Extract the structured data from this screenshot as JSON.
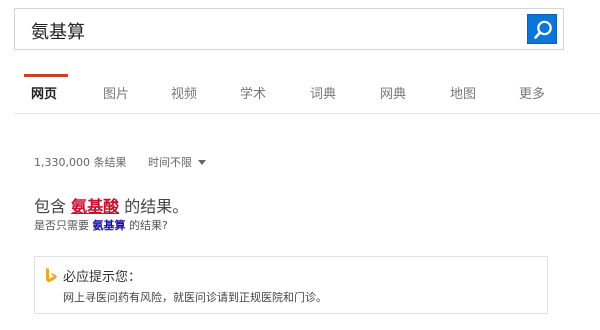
{
  "search": {
    "query": "氨基算"
  },
  "nav": {
    "tabs": [
      {
        "label": "网页",
        "active": true
      },
      {
        "label": "图片"
      },
      {
        "label": "视频"
      },
      {
        "label": "学术"
      },
      {
        "label": "词典"
      },
      {
        "label": "网典"
      },
      {
        "label": "地图"
      },
      {
        "label": "更多"
      }
    ]
  },
  "results": {
    "count": "1,330,000 条结果",
    "time_filter": "时间不限"
  },
  "suggestion": {
    "prefix": "包含",
    "corrected": "氨基酸",
    "suffix": "的结果。",
    "alt_prefix": "是否只需要",
    "alt_query": "氨基算",
    "alt_suffix": "的结果?"
  },
  "tip": {
    "title": "必应提示您：",
    "text": "网上寻医问药有风险，就医问诊请到正规医院和门诊。"
  },
  "colors": {
    "accent": "#0b76d6",
    "tab_active": "#c84321",
    "correction": "#c8102e",
    "link": "#1a0dab",
    "logo": "#f5a623"
  }
}
